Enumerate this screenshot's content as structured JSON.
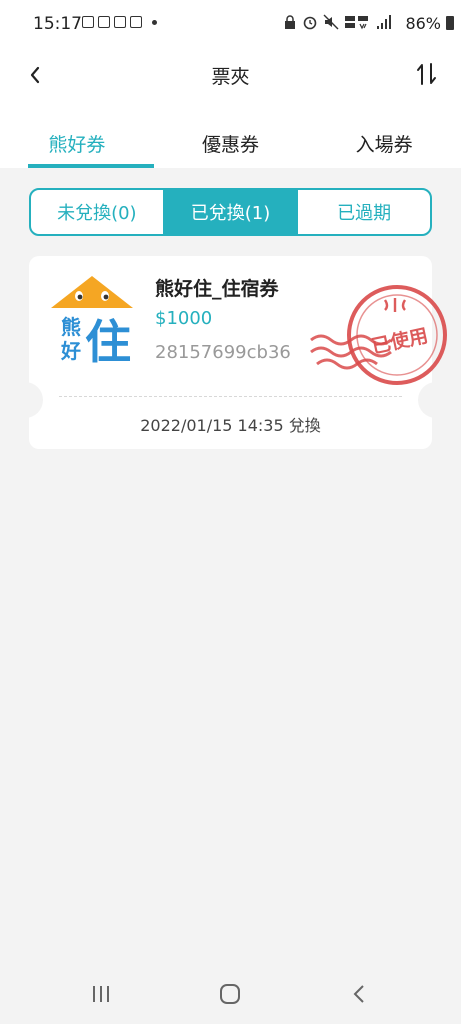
{
  "status": {
    "time": "15:17",
    "battery": "86%"
  },
  "header": {
    "title": "票夾"
  },
  "tabs": [
    {
      "label": "熊好券",
      "active": true
    },
    {
      "label": "優惠券",
      "active": false
    },
    {
      "label": "入場券",
      "active": false
    }
  ],
  "segments": [
    {
      "label": "未兌換(0)",
      "active": false
    },
    {
      "label": "已兌換(1)",
      "active": true
    },
    {
      "label": "已過期",
      "active": false
    }
  ],
  "ticket": {
    "name": "熊好住_住宿券",
    "price": "$1000",
    "code": "28157699cb36",
    "date": "2022/01/15 14:35 兌換",
    "logo_text_1": "熊",
    "logo_text_2": "好",
    "logo_text_3": "住",
    "stamp_text": "已使用"
  },
  "colors": {
    "accent": "#25b0be",
    "stamp": "#d94a4a",
    "logo_orange": "#f5a623",
    "logo_blue": "#2d8fd5"
  }
}
